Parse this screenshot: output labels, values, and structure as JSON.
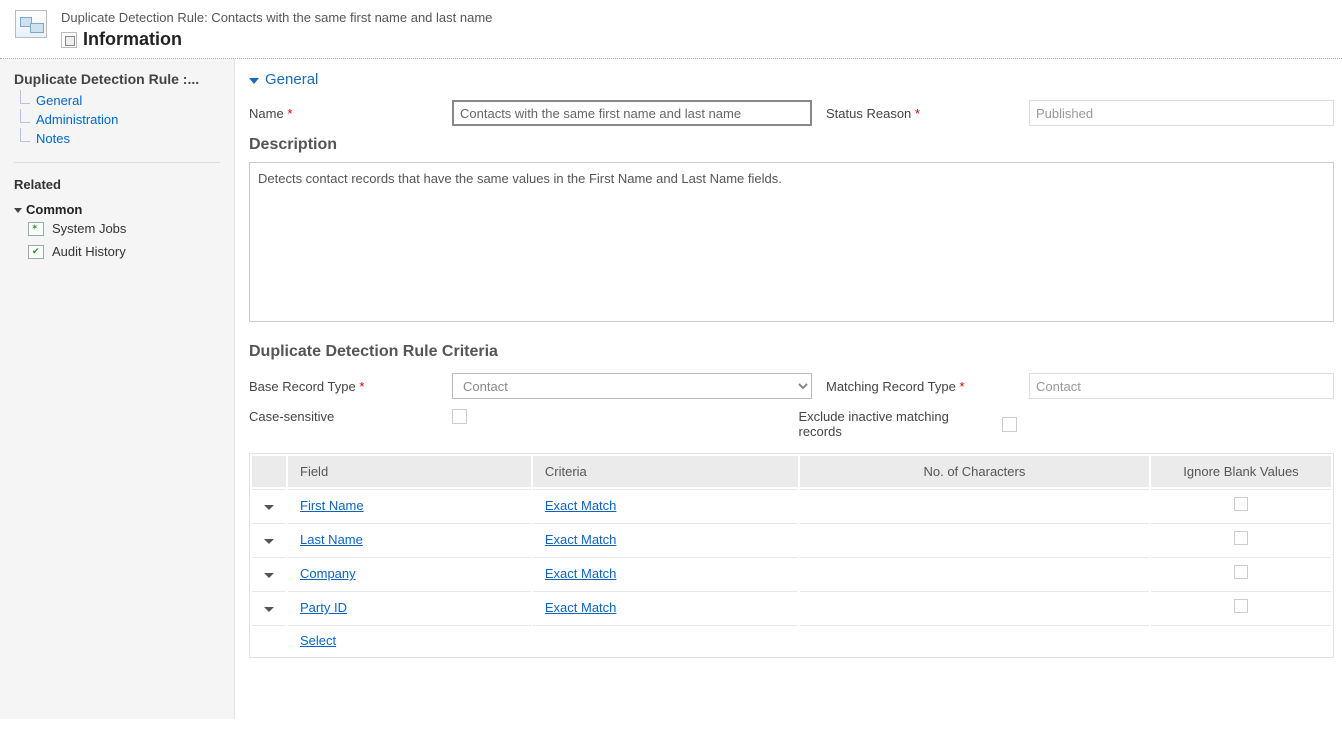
{
  "header": {
    "breadcrumb": "Duplicate Detection Rule: Contacts with the same first name and last name",
    "title": "Information"
  },
  "sidebar": {
    "title": "Duplicate Detection Rule :...",
    "tree": {
      "items": [
        "General",
        "Administration",
        "Notes"
      ]
    },
    "related_label": "Related",
    "common_label": "Common",
    "related_items": [
      "System Jobs",
      "Audit History"
    ]
  },
  "section": {
    "general_label": "General",
    "name_label": "Name",
    "name_value": "Contacts with the same first name and last name",
    "status_label": "Status Reason",
    "status_value": "Published",
    "description_label": "Description",
    "description_value": "Detects contact records that have the same values in the First Name and Last Name fields.",
    "criteria_label": "Duplicate Detection Rule Criteria",
    "base_record_label": "Base Record Type",
    "base_record_value": "Contact",
    "matching_record_label": "Matching Record Type",
    "matching_record_value": "Contact",
    "case_sensitive_label": "Case-sensitive",
    "exclude_inactive_label": "Exclude inactive matching records"
  },
  "table": {
    "headers": {
      "field": "Field",
      "criteria": "Criteria",
      "no_chars": "No. of Characters",
      "ignore_blank": "Ignore Blank Values"
    },
    "rows": [
      {
        "field": "First Name",
        "criteria": "Exact Match"
      },
      {
        "field": "Last Name",
        "criteria": "Exact Match"
      },
      {
        "field": "Company",
        "criteria": "Exact Match"
      },
      {
        "field": "Party ID",
        "criteria": "Exact Match"
      }
    ],
    "select_label": "Select"
  }
}
